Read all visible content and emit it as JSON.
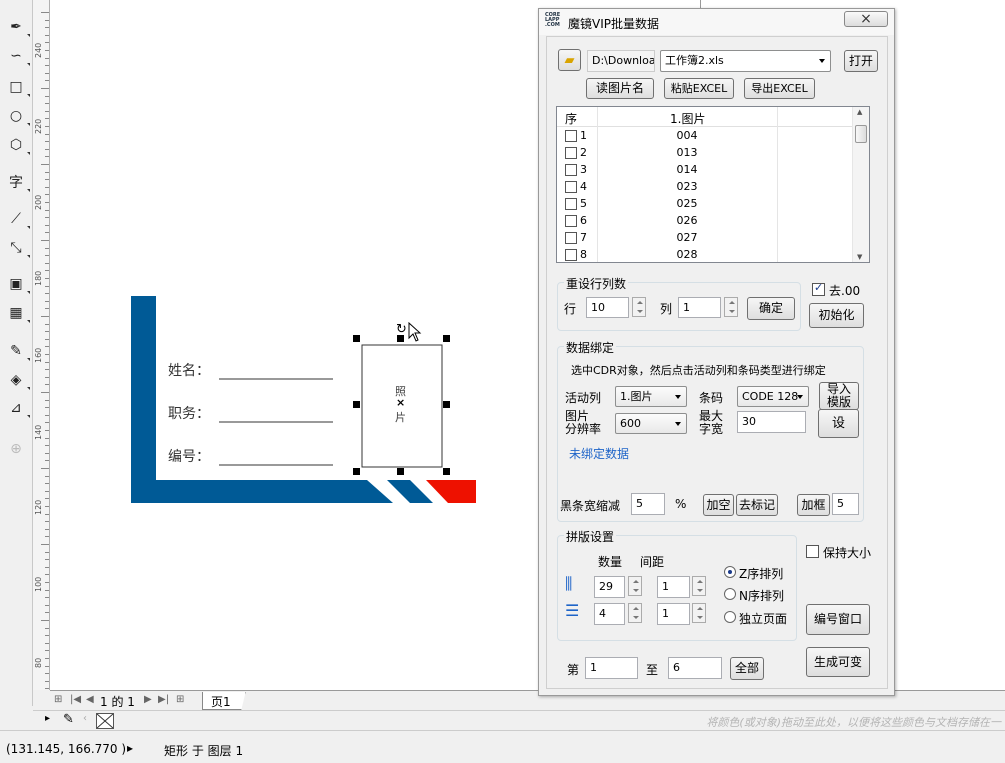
{
  "toolbox": {
    "tools": [
      {
        "name": "freehand-icon",
        "glyph": "✒"
      },
      {
        "name": "smart-draw-icon",
        "glyph": "∽"
      },
      {
        "name": "rectangle-tool-icon",
        "glyph": "□"
      },
      {
        "name": "ellipse-tool-icon",
        "glyph": "○"
      },
      {
        "name": "polygon-tool-icon",
        "glyph": "⬡"
      },
      {
        "name": "text-tool-icon",
        "glyph": "字"
      },
      {
        "name": "dimension-tool-icon",
        "glyph": "⟋"
      },
      {
        "name": "connector-tool-icon",
        "glyph": "⤡"
      },
      {
        "name": "contour-tool-icon",
        "glyph": "▣"
      },
      {
        "name": "transparency-tool-icon",
        "glyph": "▦"
      },
      {
        "name": "eyedropper-tool-icon",
        "glyph": "✎"
      },
      {
        "name": "fill-tool-icon",
        "glyph": "◈"
      },
      {
        "name": "smart-fill-icon",
        "glyph": "⊿"
      },
      {
        "name": "add-tool-icon",
        "glyph": "⊕"
      }
    ]
  },
  "ruler": {
    "labels": [
      "240",
      "220",
      "200",
      "180",
      "160",
      "140",
      "120",
      "100",
      "80"
    ]
  },
  "card": {
    "name_label": "姓名：",
    "title_label": "职务：",
    "number_label": "编号：",
    "photo_text_top": "照",
    "photo_text_bottom": "片",
    "photo_center": "×",
    "colors": {
      "blue": "#005a96",
      "red": "#ee1100"
    }
  },
  "pagebar": {
    "page_counter": "1 的 1",
    "page_tab": "页1"
  },
  "palette": {
    "hint": "将颜色(或对象)拖动至此处，以便将这些颜色与文档存储在一"
  },
  "status": {
    "coords": "(131.145, 166.770 )",
    "arrow": "▸",
    "object_info": "矩形 于 图层 1"
  },
  "dialog": {
    "logo_lines": [
      "CORE",
      "LAPP",
      ".COM"
    ],
    "title": "魔镜VIP批量数据",
    "close_glyph": "×",
    "file_path": "D:\\Download",
    "workbook": "工作簿2.xls",
    "open_button": "打开",
    "read_image_names": "读图片名",
    "paste_excel": "粘贴EXCEL",
    "export_excel": "导出EXCEL",
    "grid": {
      "headers": [
        "序",
        "1.图片"
      ],
      "rows": [
        {
          "n": "1",
          "v": "004"
        },
        {
          "n": "2",
          "v": "013"
        },
        {
          "n": "3",
          "v": "014"
        },
        {
          "n": "4",
          "v": "023"
        },
        {
          "n": "5",
          "v": "025"
        },
        {
          "n": "6",
          "v": "026"
        },
        {
          "n": "7",
          "v": "027"
        },
        {
          "n": "8",
          "v": "028"
        }
      ]
    },
    "reset_cols": {
      "title": "重设行列数",
      "row_label": "行",
      "row_value": "10",
      "col_label": "列",
      "col_value": "1",
      "confirm": "确定"
    },
    "strip00_label": "去.00",
    "strip00_checked": true,
    "init_button": "初始化",
    "binding": {
      "title": "数据绑定",
      "hint": "选中CDR对象，然后点击活动列和条码类型进行绑定",
      "active_col_label": "活动列",
      "active_col_value": "1.图片",
      "barcode_label": "条码",
      "barcode_value": "CODE 128",
      "import_template": "导入\n模版",
      "resolution_label": "图片\n分辨率",
      "resolution_value": "600",
      "max_width_label": "最大\n字宽",
      "max_width_value": "30",
      "set_button": "设",
      "unbound_link": "未绑定数据"
    },
    "bar_shrink_label": "黑条宽缩减",
    "bar_shrink_value": "5",
    "percent": "%",
    "add_space": "加空",
    "remove_mark": "去标记",
    "add_frame": "加框",
    "frame_value": "5",
    "layout": {
      "title": "拼版设置",
      "count_label": "数量",
      "spacing_label": "间距",
      "cols_count": "29",
      "cols_spacing": "1",
      "rows_count": "4",
      "rows_spacing": "1",
      "z_order": "Z序排列",
      "n_order": "N序排列",
      "single_page": "独立页面",
      "selected": "Z序排列"
    },
    "keep_size": "保持大小",
    "number_window": "编号窗口",
    "from_label": "第",
    "from_value": "1",
    "to_label": "至",
    "to_value": "6",
    "all_button": "全部",
    "generate_button": "生成可变"
  }
}
